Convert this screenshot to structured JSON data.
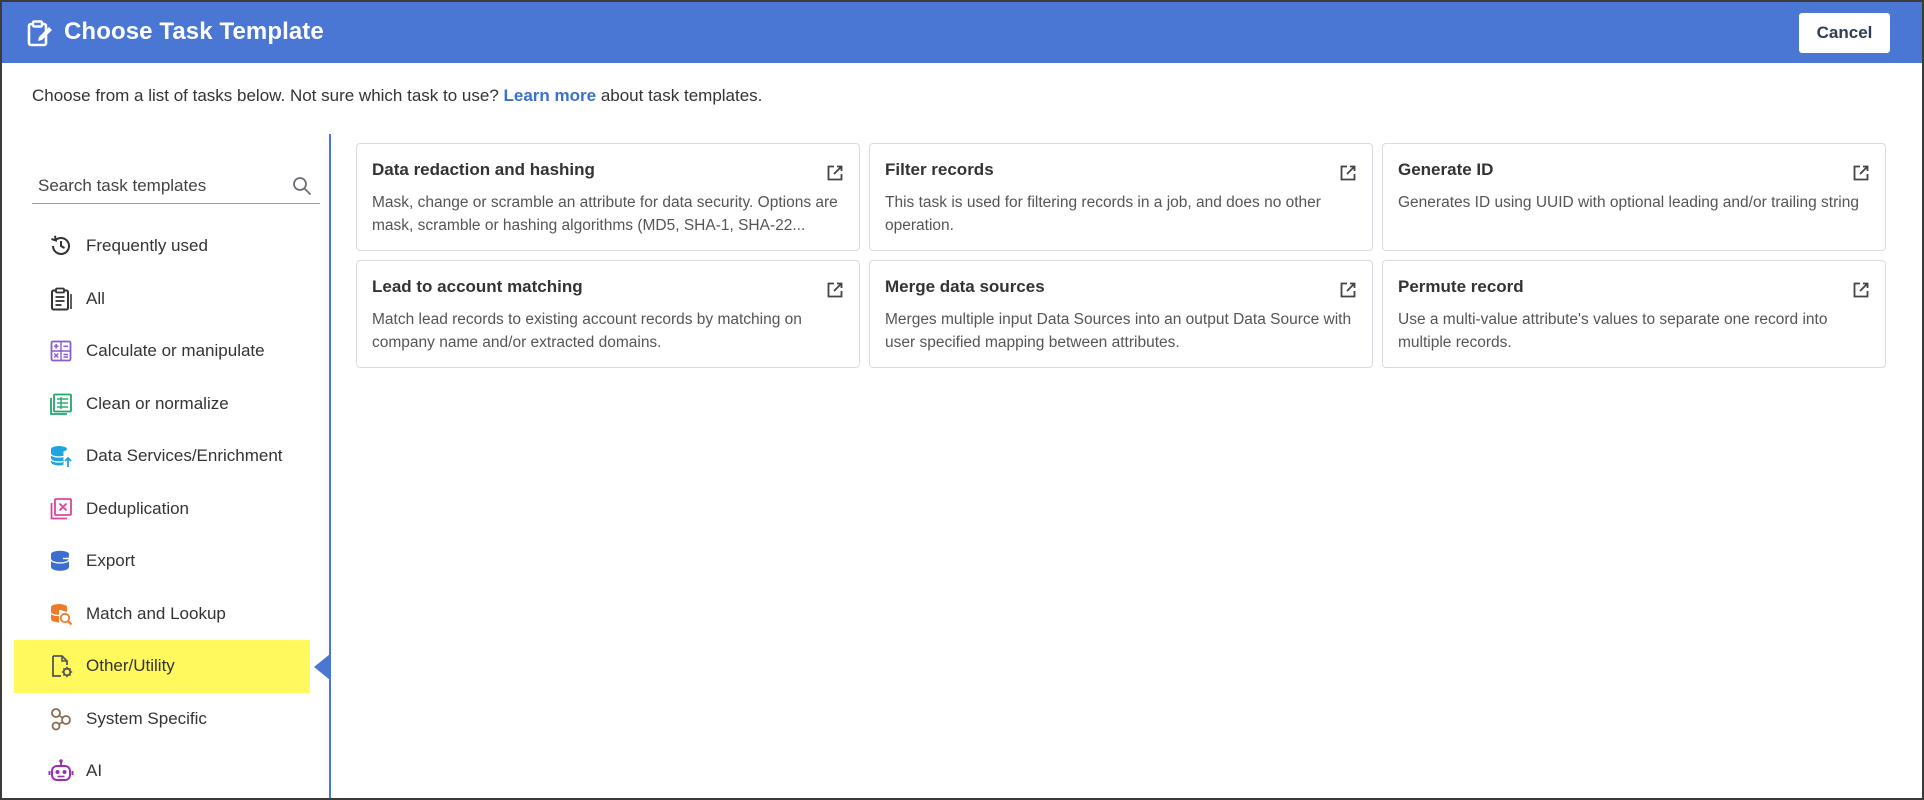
{
  "header": {
    "title": "Choose Task Template",
    "icon": "clipboard-edit-icon",
    "cancel_label": "Cancel",
    "bg_color": "#4a76d4"
  },
  "intro": {
    "text_before": "Choose from a list of tasks below. Not sure which task to use? ",
    "link": "Learn more",
    "text_after": " about task templates."
  },
  "search": {
    "placeholder": "Search task templates",
    "value": ""
  },
  "categories": [
    {
      "label": "Frequently used",
      "icon": "history-icon",
      "color": "#333333"
    },
    {
      "label": "All",
      "icon": "clipboard-list-icon",
      "color": "#333333"
    },
    {
      "label": "Calculate or manipulate",
      "icon": "calculator-icon",
      "color": "#8a5cd1"
    },
    {
      "label": "Clean or normalize",
      "icon": "spreadsheet-icon",
      "color": "#21a86b"
    },
    {
      "label": "Data Services/Enrichment",
      "icon": "database-upload-icon",
      "color": "#1fa4e0"
    },
    {
      "label": "Deduplication",
      "icon": "duplicate-remove-icon",
      "color": "#e0449a"
    },
    {
      "label": "Export",
      "icon": "database-export-icon",
      "color": "#3a6fd0"
    },
    {
      "label": "Match and Lookup",
      "icon": "database-search-icon",
      "color": "#ef7a2a"
    },
    {
      "label": "Other/Utility",
      "icon": "file-gear-icon",
      "color": "#555555",
      "active": true
    },
    {
      "label": "System Specific",
      "icon": "nodes-icon",
      "color": "#8a6a50"
    },
    {
      "label": "AI",
      "icon": "robot-icon",
      "color": "#9a2fb3"
    }
  ],
  "cards": [
    {
      "title": "Data redaction and hashing",
      "desc": "Mask, change or scramble an attribute for data security. Options are mask, scramble or hashing algorithms (MD5, SHA-1, SHA-22..."
    },
    {
      "title": "Filter records",
      "desc": "This task is used for filtering records in a job, and does no other operation."
    },
    {
      "title": "Generate ID",
      "desc": "Generates ID using UUID with optional leading and/or trailing string"
    },
    {
      "title": "Lead to account matching",
      "desc": "Match lead records to existing account records by matching on company name and/or extracted domains."
    },
    {
      "title": "Merge data sources",
      "desc": "Merges multiple input Data Sources into an output Data Source with user specified mapping between attributes."
    },
    {
      "title": "Permute record",
      "desc": "Use a multi-value attribute's values to separate one record into multiple records."
    }
  ]
}
